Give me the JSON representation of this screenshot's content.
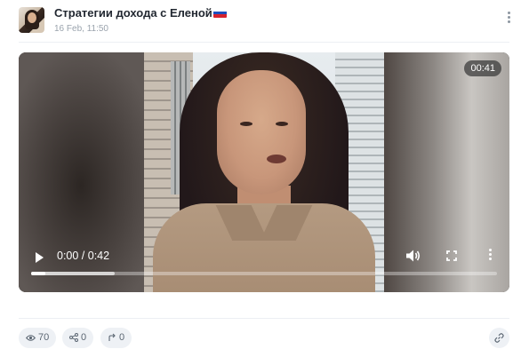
{
  "post": {
    "channel_name": "Стратегии дохода с Еленой",
    "channel_flag_icon": "russia-flag-icon",
    "date": "16 Feb, 11:50"
  },
  "video": {
    "duration_badge": "00:41",
    "time_display": "0:00 / 0:42",
    "played_fraction": 0.03,
    "buffered_fraction": 0.18
  },
  "stats": {
    "views": "70",
    "shares": "0",
    "forwards": "0"
  },
  "icons": {
    "views": "eye-icon",
    "shares": "share-icon",
    "forwards": "forward-icon",
    "link": "link-icon",
    "menu": "vertical-dots-icon"
  },
  "colors": {
    "title": "#222831",
    "muted": "#9aa3ad",
    "pill_bg": "#eef1f5"
  }
}
